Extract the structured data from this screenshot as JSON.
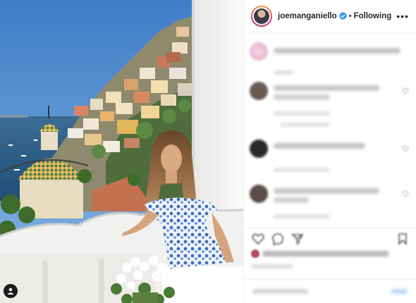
{
  "post": {
    "author": {
      "username": "joemanganiello",
      "verified": true,
      "follow_state": "Following",
      "separator": "•"
    },
    "header_icons": {
      "more": "more-options-icon",
      "verified": "verified-badge-icon"
    },
    "photo": {
      "tag_icon": "user-tag-icon"
    },
    "colors": {
      "text": "#262626",
      "verified_blue": "#3897f0",
      "divider": "#efefef",
      "blur_grey": "#c7c7c7",
      "ring_gradient": [
        "#f9a33a",
        "#e1306c",
        "#c13584"
      ]
    },
    "action_icons": [
      "heart-icon",
      "comment-icon",
      "share-icon",
      "save-icon"
    ],
    "comments_visible": 5
  }
}
